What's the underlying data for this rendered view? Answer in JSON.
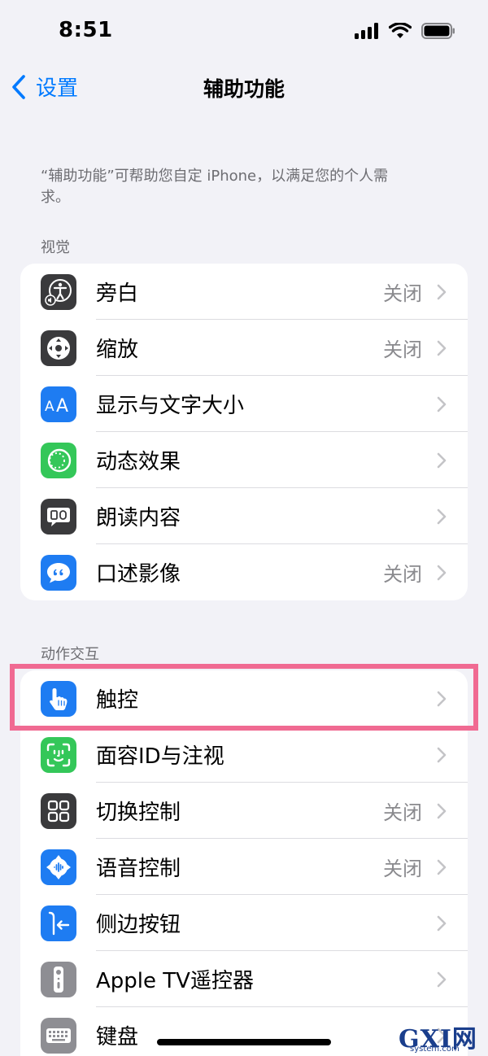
{
  "status_bar": {
    "time": "8:51"
  },
  "nav": {
    "back_label": "设置",
    "title": "辅助功能"
  },
  "intro": "“辅助功能”可帮助您自定 iPhone，以满足您的个人需求。",
  "sections": [
    {
      "header": "视觉",
      "items": [
        {
          "label": "旁白",
          "value": "关闭",
          "icon": "voiceover-icon",
          "color": "#3A3A3C"
        },
        {
          "label": "缩放",
          "value": "关闭",
          "icon": "zoom-icon",
          "color": "#3A3A3C"
        },
        {
          "label": "显示与文字大小",
          "value": "",
          "icon": "text-size-icon",
          "color": "#1E7CF2"
        },
        {
          "label": "动态效果",
          "value": "",
          "icon": "motion-icon",
          "color": "#34C759"
        },
        {
          "label": "朗读内容",
          "value": "",
          "icon": "spoken-content-icon",
          "color": "#3A3A3C"
        },
        {
          "label": "口述影像",
          "value": "关闭",
          "icon": "audio-description-icon",
          "color": "#1E7CF2"
        }
      ]
    },
    {
      "header": "动作交互",
      "items": [
        {
          "label": "触控",
          "value": "",
          "icon": "touch-icon",
          "color": "#1E7CF2"
        },
        {
          "label": "面容ID与注视",
          "value": "",
          "icon": "face-id-icon",
          "color": "#34C759"
        },
        {
          "label": "切换控制",
          "value": "关闭",
          "icon": "switch-control-icon",
          "color": "#3A3A3C"
        },
        {
          "label": "语音控制",
          "value": "关闭",
          "icon": "voice-control-icon",
          "color": "#1E7CF2"
        },
        {
          "label": "侧边按钮",
          "value": "",
          "icon": "side-button-icon",
          "color": "#1E7CF2"
        },
        {
          "label": "Apple TV遥控器",
          "value": "",
          "icon": "apple-tv-remote-icon",
          "color": "#8E8E93"
        },
        {
          "label": "键盘",
          "value": "",
          "icon": "keyboard-icon",
          "color": "#8E8E93"
        }
      ]
    }
  ],
  "watermark": {
    "main": "GXI网",
    "sub": "system.com"
  },
  "accent_color": "#007AFF",
  "highlight_color": "#F06A92"
}
